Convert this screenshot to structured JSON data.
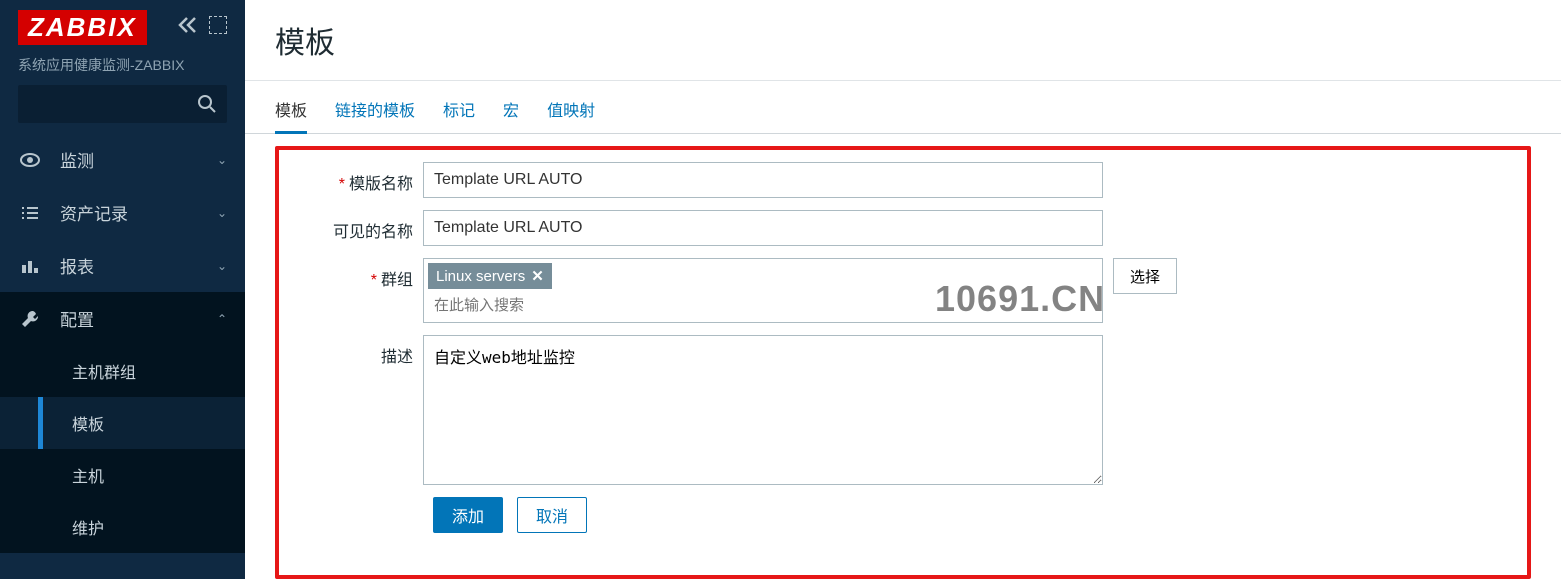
{
  "sidebar": {
    "logo": "ZABBIX",
    "subtitle": "系统应用健康监测-ZABBIX",
    "items": [
      {
        "label": "监测",
        "icon": "eye"
      },
      {
        "label": "资产记录",
        "icon": "list"
      },
      {
        "label": "报表",
        "icon": "bar"
      },
      {
        "label": "配置",
        "icon": "wrench"
      }
    ],
    "sub_items": [
      {
        "label": "主机群组"
      },
      {
        "label": "模板"
      },
      {
        "label": "主机"
      },
      {
        "label": "维护"
      }
    ]
  },
  "page": {
    "title": "模板",
    "tabs": [
      "模板",
      "链接的模板",
      "标记",
      "宏",
      "值映射"
    ]
  },
  "form": {
    "template_name_label": "模版名称",
    "template_name_value": "Template URL AUTO",
    "visible_name_label": "可见的名称",
    "visible_name_value": "Template URL AUTO",
    "group_label": "群组",
    "group_tag": "Linux servers",
    "group_placeholder": "在此输入搜索",
    "select_btn": "选择",
    "desc_label": "描述",
    "desc_value": "自定义web地址监控",
    "add_btn": "添加",
    "cancel_btn": "取消"
  },
  "watermark": "10691.CN"
}
